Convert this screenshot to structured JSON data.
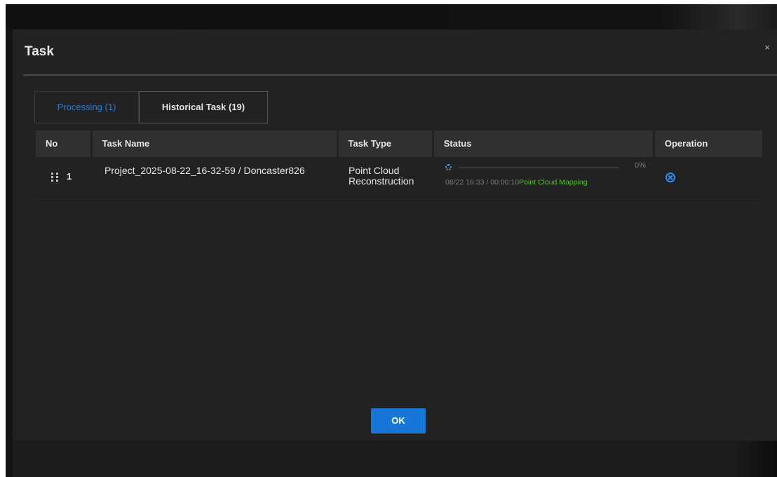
{
  "dialog": {
    "title": "Task",
    "close_icon": "close-icon",
    "close_glyph": "×",
    "ok_label": "OK"
  },
  "tabs": [
    {
      "label": "Processing (1)",
      "active": true
    },
    {
      "label": "Historical Task (19)",
      "active": false
    }
  ],
  "table": {
    "headers": [
      "No",
      "Task Name",
      "Task Type",
      "Status",
      "Operation"
    ],
    "rows": [
      {
        "no": "1",
        "name": "Project_2025-08-22_16-32-59 / Doncaster826",
        "type": "Point Cloud Reconstruction",
        "progress": 0,
        "progress_label": "0%",
        "time": "08/22 16:33 / 00:00:10",
        "stage": "Point Cloud Mapping",
        "status_icon": "loading-spinner-icon",
        "operation_icon": "cancel-circle-icon"
      }
    ]
  },
  "colors": {
    "accent": "#2a7cd6",
    "stage_text": "#52c41a",
    "ok_button": "#1677d6"
  }
}
